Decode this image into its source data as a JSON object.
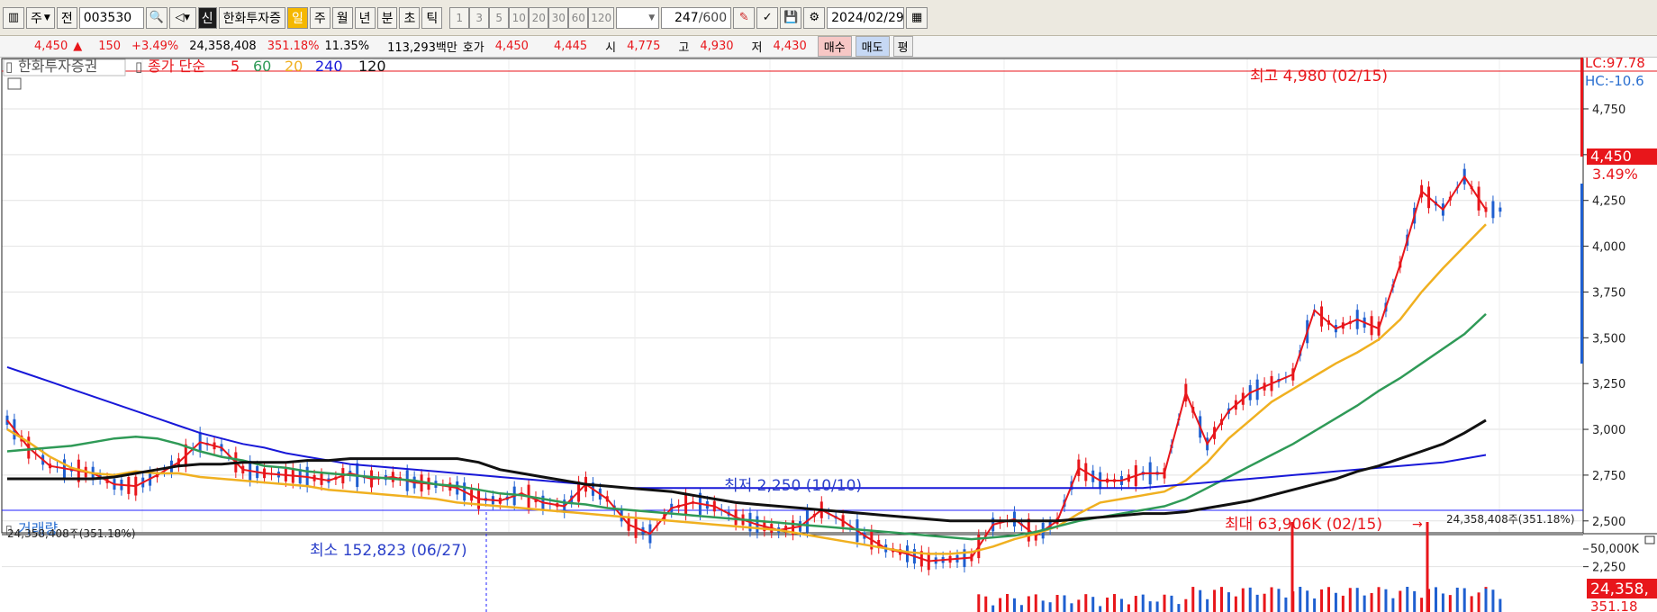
{
  "toolbar": {
    "market_type": "주",
    "prev_label": "전",
    "stock_code": "003530",
    "badge": "신",
    "stock_name": "한화투자증",
    "periods": [
      "일",
      "주",
      "월",
      "년",
      "분",
      "초",
      "틱"
    ],
    "selected_period": "일",
    "intervals": [
      "1",
      "3",
      "5",
      "10",
      "20",
      "30",
      "60",
      "120"
    ],
    "count_value": "247",
    "count_total": "/600",
    "date": "2024/02/29"
  },
  "quote": {
    "price": "4,450",
    "change_arrow": "▲",
    "change": "150",
    "change_pct": "+3.49%",
    "volume": "24,358,408",
    "volume_ratio": "351.18%",
    "turnover": "11.35%",
    "amount": "113,293백만",
    "bid_label": "호가",
    "ask": "4,450",
    "bid": "4,445",
    "open_label": "시",
    "open": "4,775",
    "high_label": "고",
    "high": "4,930",
    "low_label": "저",
    "low": "4,430",
    "buy_button": "매수",
    "sell_button": "매도",
    "avg_button": "평"
  },
  "legend": {
    "name": "한화투자증권",
    "series_label": "종가 단순",
    "ma_periods": [
      "5",
      "60",
      "20",
      "240",
      "120"
    ]
  },
  "annotations": {
    "max_label": "최고 4,980 (02/15)",
    "min_label": "최저 2,250 (10/10)"
  },
  "right_axis": {
    "lc": "LC:97.78",
    "hc": "HC:-10.6",
    "current_price": "4,450",
    "current_pct": "3.49%"
  },
  "volume_panel": {
    "title": "거래량",
    "left_info": "24,358,408주(351.18%)",
    "right_info": "24,358,408주(351.18%)",
    "min_label": "최소 152,823 (06/27)",
    "max_label": "최대 63,906K (02/15)",
    "axis_tick": "50,000K",
    "current_volume": "24,358,",
    "current_pct": "351.18"
  },
  "colors": {
    "up": "#e8161b",
    "down": "#1f5fd0",
    "ma5": "#e8161b",
    "ma20": "#f0b020",
    "ma60": "#2f9a57",
    "ma120": "#111111",
    "ma240": "#1818d8"
  },
  "chart_data": {
    "type": "line",
    "title": "한화투자증권",
    "y_ticks": [
      2250,
      2500,
      2750,
      3000,
      3250,
      3500,
      3750,
      4000,
      4250,
      4500,
      4750
    ],
    "ylim": [
      2150,
      5030
    ],
    "series": [
      {
        "name": "5",
        "values": [
          3050,
          2900,
          2800,
          2780,
          2760,
          2700,
          2690,
          2750,
          2820,
          2930,
          2900,
          2780,
          2760,
          2750,
          2740,
          2720,
          2760,
          2730,
          2740,
          2710,
          2700,
          2680,
          2620,
          2610,
          2650,
          2600,
          2580,
          2700,
          2620,
          2480,
          2430,
          2570,
          2600,
          2580,
          2520,
          2480,
          2450,
          2470,
          2560,
          2500,
          2420,
          2350,
          2320,
          2280,
          2290,
          2300,
          2480,
          2510,
          2420,
          2500,
          2790,
          2720,
          2720,
          2760,
          2760,
          3200,
          2920,
          3100,
          3200,
          3250,
          3300,
          3650,
          3550,
          3600,
          3550,
          3900,
          4300,
          4200,
          4380,
          4200
        ]
      },
      {
        "name": "20",
        "values": [
          3000,
          2930,
          2850,
          2790,
          2760,
          2750,
          2770,
          2760,
          2760,
          2740,
          2730,
          2720,
          2710,
          2700,
          2690,
          2670,
          2660,
          2650,
          2640,
          2630,
          2620,
          2600,
          2590,
          2580,
          2570,
          2560,
          2550,
          2540,
          2530,
          2520,
          2510,
          2500,
          2490,
          2480,
          2470,
          2460,
          2450,
          2430,
          2410,
          2390,
          2370,
          2350,
          2330,
          2320,
          2320,
          2330,
          2360,
          2400,
          2430,
          2470,
          2540,
          2600,
          2620,
          2640,
          2660,
          2720,
          2820,
          2950,
          3050,
          3150,
          3220,
          3290,
          3360,
          3420,
          3490,
          3600,
          3750,
          3880,
          4000,
          4120
        ]
      },
      {
        "name": "60",
        "values": [
          2880,
          2890,
          2900,
          2910,
          2930,
          2950,
          2960,
          2950,
          2920,
          2880,
          2850,
          2830,
          2800,
          2790,
          2770,
          2760,
          2750,
          2740,
          2730,
          2720,
          2700,
          2690,
          2670,
          2650,
          2640,
          2620,
          2600,
          2590,
          2570,
          2560,
          2550,
          2540,
          2530,
          2520,
          2510,
          2500,
          2490,
          2480,
          2470,
          2460,
          2450,
          2440,
          2430,
          2420,
          2410,
          2400,
          2410,
          2420,
          2440,
          2470,
          2500,
          2520,
          2540,
          2560,
          2580,
          2620,
          2680,
          2740,
          2800,
          2860,
          2920,
          2990,
          3060,
          3130,
          3210,
          3280,
          3360,
          3440,
          3520,
          3630
        ]
      },
      {
        "name": "240",
        "values": [
          3340,
          3300,
          3260,
          3220,
          3180,
          3140,
          3100,
          3060,
          3020,
          2980,
          2950,
          2920,
          2900,
          2870,
          2850,
          2830,
          2810,
          2800,
          2790,
          2780,
          2770,
          2760,
          2750,
          2740,
          2730,
          2720,
          2710,
          2700,
          2690,
          2680,
          2680,
          2680,
          2680,
          2680,
          2680,
          2680,
          2680,
          2680,
          2680,
          2680,
          2680,
          2680,
          2680,
          2680,
          2680,
          2680,
          2680,
          2680,
          2680,
          2680,
          2680,
          2680,
          2680,
          2680,
          2690,
          2700,
          2710,
          2720,
          2730,
          2740,
          2750,
          2760,
          2770,
          2780,
          2790,
          2800,
          2810,
          2820,
          2840,
          2860
        ]
      },
      {
        "name": "120",
        "values": [
          2730,
          2730,
          2730,
          2730,
          2730,
          2740,
          2760,
          2780,
          2800,
          2810,
          2810,
          2820,
          2820,
          2820,
          2830,
          2830,
          2840,
          2840,
          2840,
          2840,
          2840,
          2840,
          2820,
          2780,
          2760,
          2740,
          2720,
          2700,
          2690,
          2680,
          2670,
          2660,
          2640,
          2620,
          2600,
          2590,
          2580,
          2570,
          2560,
          2550,
          2540,
          2530,
          2520,
          2510,
          2500,
          2500,
          2500,
          2500,
          2500,
          2500,
          2510,
          2520,
          2530,
          2540,
          2540,
          2550,
          2570,
          2590,
          2610,
          2640,
          2670,
          2700,
          2730,
          2770,
          2800,
          2840,
          2880,
          2920,
          2980,
          3050
        ]
      }
    ]
  }
}
